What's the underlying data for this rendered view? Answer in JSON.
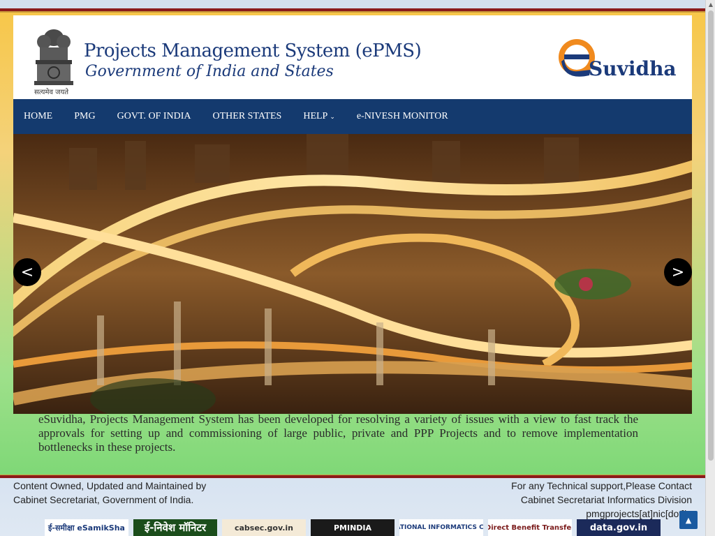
{
  "header": {
    "emblem_motto": "सत्यमेव जयते",
    "title": "Projects Management System (ePMS)",
    "subtitle": "Government of India and States",
    "logo_text": "Suvidha"
  },
  "nav": {
    "items": [
      {
        "label": "HOME"
      },
      {
        "label": "PMG"
      },
      {
        "label": "GOVT. OF INDIA"
      },
      {
        "label": "OTHER STATES"
      },
      {
        "label": "HELP"
      },
      {
        "label": "e-NIVESH MONITOR"
      }
    ]
  },
  "slider": {
    "prev_label": "<",
    "next_label": ">"
  },
  "description": "eSuvidha, Projects Management System has been developed for resolving a variety of issues with a view to fast track the approvals for setting up and commissioning of large public, private and PPP Projects and to remove implementation bottlenecks in these projects.",
  "footer": {
    "left_line1": "Content Owned, Updated and Maintained by",
    "left_line2": "Cabinet Secretariat, Government of India.",
    "right_line1": "For any Technical support,Please Contact",
    "right_line2": "Cabinet Secretariat Informatics Division",
    "right_line3": "pmgprojects[at]nic[dot]in"
  },
  "logos": [
    {
      "text": "ई-समीक्षा eSamikSha",
      "color": "#1b3a7a",
      "bg": "#ffffff"
    },
    {
      "text": "ई-निवेश मॉनिटर",
      "color": "#ffffff",
      "bg": "#1b4d1b"
    },
    {
      "text": "cabsec.gov.in",
      "color": "#333333",
      "bg": "#f4ead7"
    },
    {
      "text": "PMINDIA",
      "color": "#ffffff",
      "bg": "#1a1a1a"
    },
    {
      "text": "NIC NATIONAL INFORMATICS CENTRE",
      "color": "#1b3a7a",
      "bg": "#ffffff"
    },
    {
      "text": "Direct Benefit Transfer",
      "color": "#7a1a1a",
      "bg": "#ffffff"
    },
    {
      "text": "data.gov.in",
      "color": "#ffffff",
      "bg": "#1b2a5a"
    }
  ],
  "colors": {
    "nav_bg": "#143a6e",
    "title_blue": "#1b3a7a",
    "accent_orange": "#f08a1e",
    "accent_red": "#8b1a1a"
  }
}
